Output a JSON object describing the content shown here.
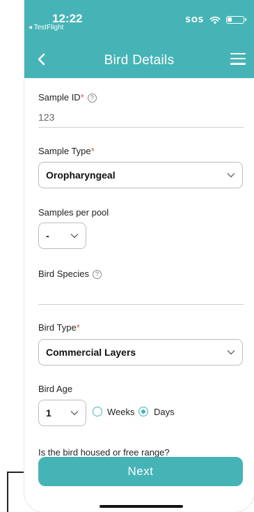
{
  "status": {
    "time": "12:22",
    "back_app": "◂ TestFlight",
    "sos": "SOS"
  },
  "nav": {
    "title": "Bird Details"
  },
  "fields": {
    "sample_id": {
      "label": "Sample ID",
      "required": "*",
      "value": "123"
    },
    "sample_type": {
      "label": "Sample Type",
      "required": "*",
      "value": "Oropharyngeal"
    },
    "samples_per_pool": {
      "label": "Samples per pool",
      "value": "-"
    },
    "bird_species": {
      "label": "Bird Species",
      "value": ""
    },
    "bird_type": {
      "label": "Bird Type",
      "required": "*",
      "value": "Commercial Layers"
    },
    "bird_age": {
      "label": "Bird Age",
      "value": "1",
      "unit_options": [
        "Weeks",
        "Days"
      ],
      "selected_unit": "Days"
    },
    "housing_question": {
      "label": "Is the bird housed or free range?"
    }
  },
  "actions": {
    "next_label": "Next"
  },
  "colors": {
    "accent": "#46b4b6",
    "required": "#e04a4a"
  }
}
